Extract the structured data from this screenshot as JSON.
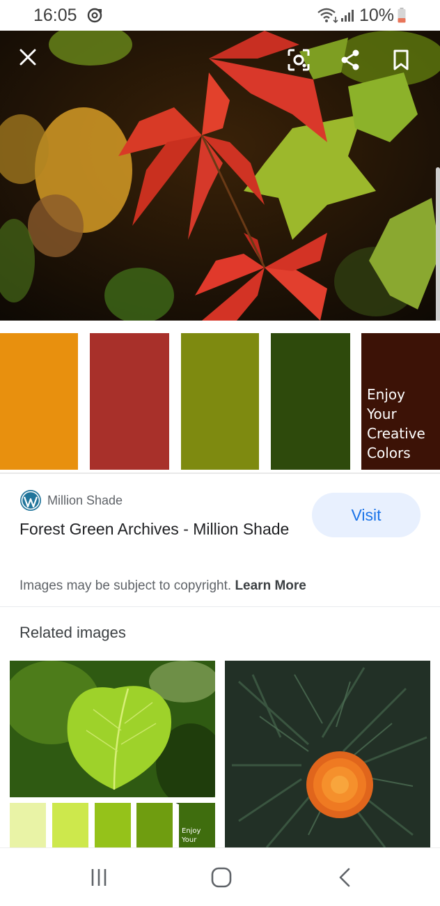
{
  "status_bar": {
    "time": "16:05",
    "battery_text": "10%",
    "icons": [
      "sync-icon",
      "wifi-icon",
      "signal-icon",
      "battery-icon"
    ]
  },
  "viewer": {
    "icons": [
      "close-icon",
      "lens-icon",
      "share-icon",
      "bookmark-icon"
    ]
  },
  "swatches": {
    "colors": [
      "#E8900E",
      "#A8302A",
      "#7E8A10",
      "#2E4A0C",
      "#3C1206"
    ],
    "caption": [
      "Enjoy",
      "Your",
      "Creative",
      "Colors"
    ]
  },
  "result": {
    "source_name": "Million Shade",
    "title": "Forest Green Archives - Million Shade",
    "visit_label": "Visit",
    "copyright_text": "Images may be subject to copyright.",
    "learn_more": "Learn More"
  },
  "related": {
    "heading": "Related images",
    "thumb_caption": [
      "Enjoy",
      "Your"
    ],
    "thumb_colors": [
      "#e9f3a6",
      "#cde84c",
      "#95c21a",
      "#6f9d10",
      "#3f6d0e"
    ]
  },
  "nav": {
    "icons": [
      "recent-apps-icon",
      "home-icon",
      "back-icon"
    ]
  }
}
